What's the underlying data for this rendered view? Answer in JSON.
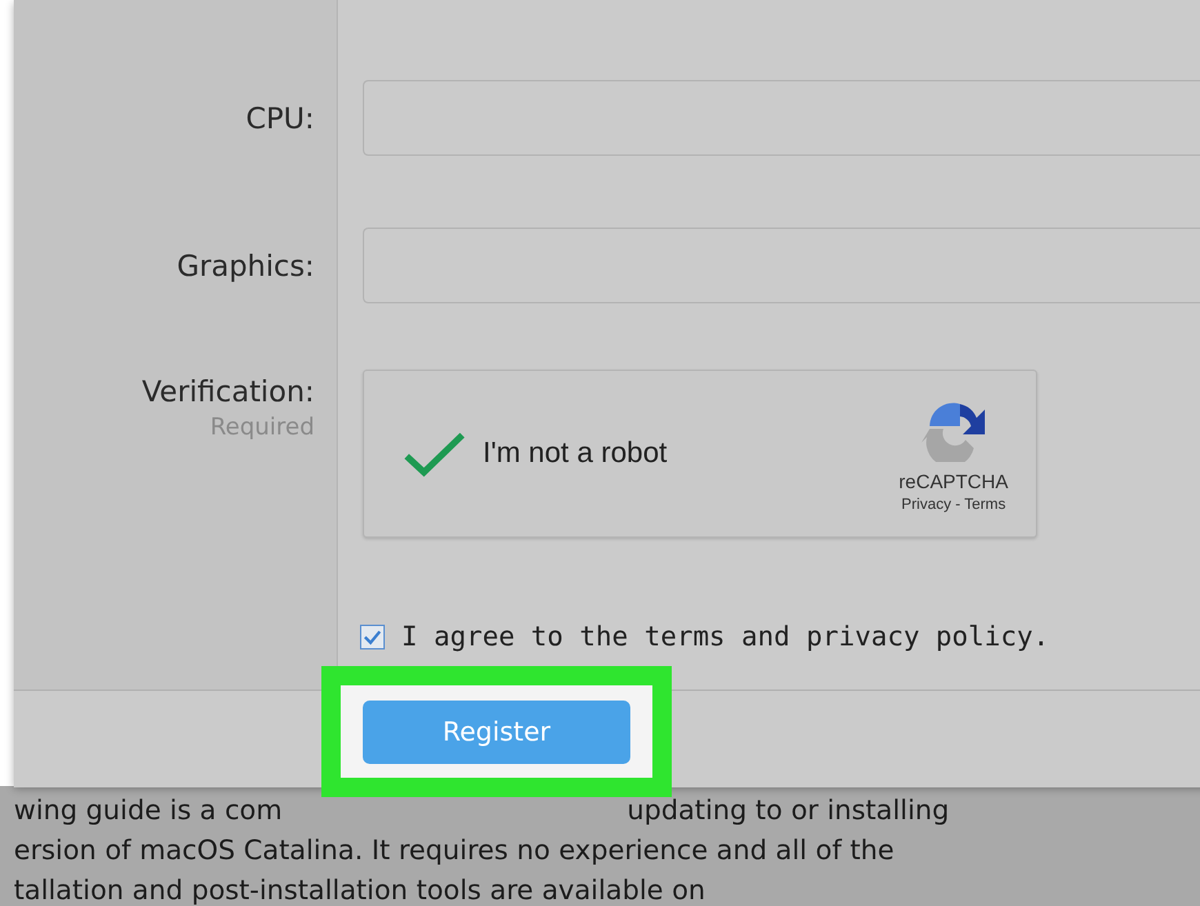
{
  "form": {
    "fields": [
      {
        "label": "CPU:"
      },
      {
        "label": "Graphics:"
      }
    ],
    "verification": {
      "label": "Verification:",
      "hint": "Required",
      "captcha": {
        "label": "I'm not a robot",
        "checked": true,
        "brand": "reCAPTCHA",
        "links": "Privacy - Terms"
      }
    },
    "agree": {
      "label": "I agree to the terms and privacy policy.",
      "checked": true
    },
    "register_button": "Register"
  },
  "background_text": {
    "lines": [
      [
        "wing guide is a com",
        "updating to or installing"
      ],
      [
        "ersion of macOS Catalina. It requires no experience and all of the"
      ],
      [
        "tallation and post-installation tools are available on"
      ]
    ]
  }
}
